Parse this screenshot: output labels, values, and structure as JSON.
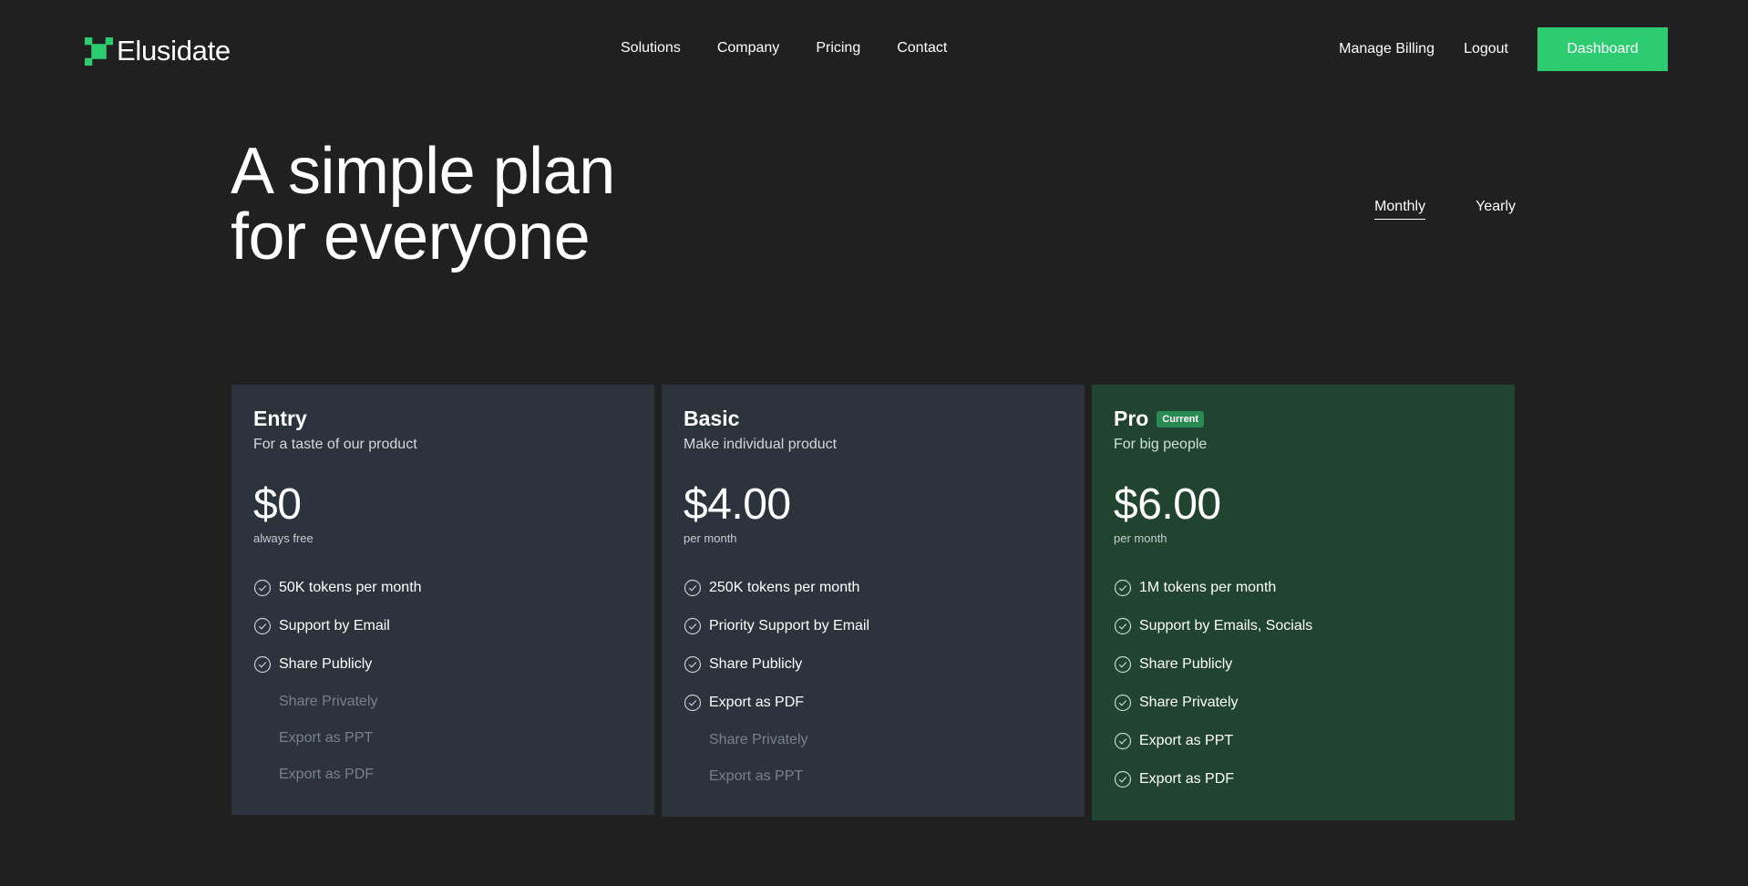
{
  "brand": {
    "name": "Elusidate",
    "accent": "#2ecc71"
  },
  "nav": {
    "items": [
      {
        "label": "Solutions"
      },
      {
        "label": "Company"
      },
      {
        "label": "Pricing"
      },
      {
        "label": "Contact"
      }
    ],
    "manage_billing": "Manage Billing",
    "logout": "Logout",
    "dashboard": "Dashboard"
  },
  "hero": {
    "title_line1": "A simple plan",
    "title_line2": "for everyone"
  },
  "billing": {
    "monthly": "Monthly",
    "yearly": "Yearly",
    "selected": "Monthly"
  },
  "plans": [
    {
      "name": "Entry",
      "subtitle": "For a taste of our product",
      "price": "$0",
      "period": "always free",
      "features": [
        {
          "label": "50K tokens per month",
          "included": true
        },
        {
          "label": "Support by Email",
          "included": true
        },
        {
          "label": "Share Publicly",
          "included": true
        },
        {
          "label": "Share Privately",
          "included": false
        },
        {
          "label": "Export as PPT",
          "included": false
        },
        {
          "label": "Export as PDF",
          "included": false
        }
      ]
    },
    {
      "name": "Basic",
      "subtitle": "Make individual product",
      "price": "$4.00",
      "period": "per month",
      "features": [
        {
          "label": "250K tokens per month",
          "included": true
        },
        {
          "label": "Priority Support by Email",
          "included": true
        },
        {
          "label": "Share Publicly",
          "included": true
        },
        {
          "label": "Export as PDF",
          "included": true
        },
        {
          "label": "Share Privately",
          "included": false
        },
        {
          "label": "Export as PPT",
          "included": false
        }
      ]
    },
    {
      "name": "Pro",
      "badge": "Current",
      "subtitle": "For big people",
      "price": "$6.00",
      "period": "per month",
      "features": [
        {
          "label": "1M tokens per month",
          "included": true
        },
        {
          "label": "Support by Emails, Socials",
          "included": true
        },
        {
          "label": "Share Publicly",
          "included": true
        },
        {
          "label": "Share Privately",
          "included": true
        },
        {
          "label": "Export as PPT",
          "included": true
        },
        {
          "label": "Export as PDF",
          "included": true
        }
      ]
    }
  ]
}
